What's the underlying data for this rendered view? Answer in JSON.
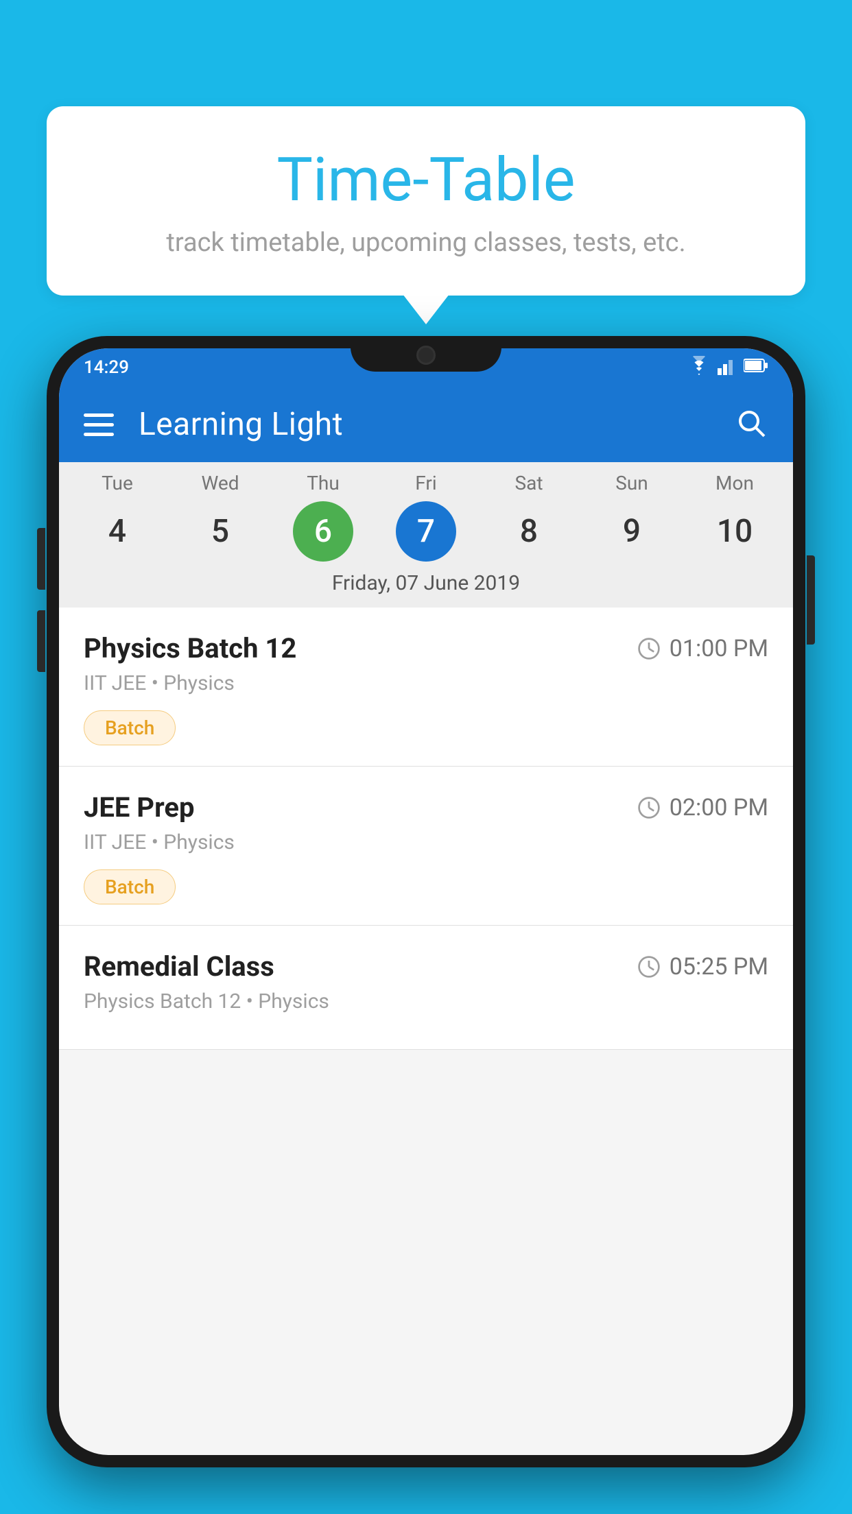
{
  "background_color": "#1ab8e8",
  "tooltip": {
    "title": "Time-Table",
    "subtitle": "track timetable, upcoming classes, tests, etc."
  },
  "phone": {
    "status_bar": {
      "time": "14:29"
    },
    "app_bar": {
      "title": "Learning Light"
    },
    "calendar": {
      "days": [
        {
          "name": "Tue",
          "num": "4",
          "state": "normal"
        },
        {
          "name": "Wed",
          "num": "5",
          "state": "normal"
        },
        {
          "name": "Thu",
          "num": "6",
          "state": "today"
        },
        {
          "name": "Fri",
          "num": "7",
          "state": "selected"
        },
        {
          "name": "Sat",
          "num": "8",
          "state": "normal"
        },
        {
          "name": "Sun",
          "num": "9",
          "state": "normal"
        },
        {
          "name": "Mon",
          "num": "10",
          "state": "normal"
        }
      ],
      "selected_date_label": "Friday, 07 June 2019"
    },
    "classes": [
      {
        "name": "Physics Batch 12",
        "time": "01:00 PM",
        "meta": "IIT JEE • Physics",
        "tag": "Batch"
      },
      {
        "name": "JEE Prep",
        "time": "02:00 PM",
        "meta": "IIT JEE • Physics",
        "tag": "Batch"
      },
      {
        "name": "Remedial Class",
        "time": "05:25 PM",
        "meta": "Physics Batch 12 • Physics",
        "tag": ""
      }
    ]
  }
}
